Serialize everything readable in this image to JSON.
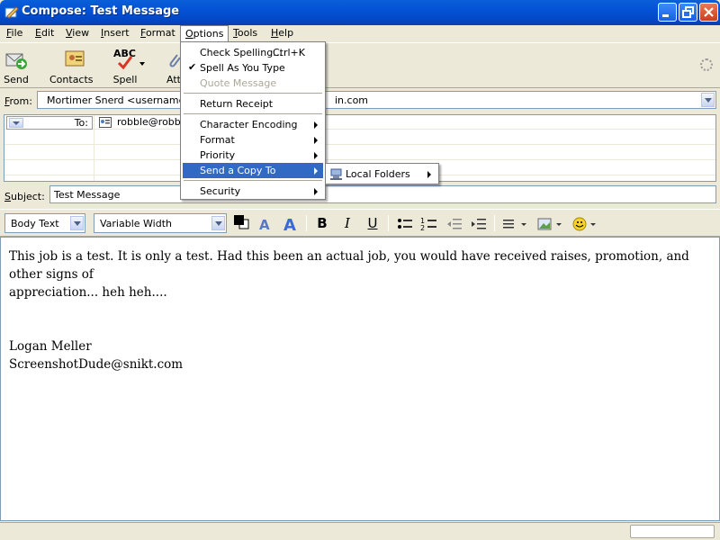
{
  "window": {
    "title": "Compose: Test Message"
  },
  "menubar": {
    "items": [
      {
        "label": "File",
        "u": "F",
        "rest": "ile"
      },
      {
        "label": "Edit",
        "u": "E",
        "rest": "dit"
      },
      {
        "label": "View",
        "u": "V",
        "rest": "iew"
      },
      {
        "label": "Insert",
        "u": "I",
        "rest": "nsert"
      },
      {
        "label": "Format",
        "u": "F",
        "rest": "ormat"
      },
      {
        "label": "Options",
        "u": "O",
        "rest": "ptions"
      },
      {
        "label": "Tools",
        "u": "T",
        "rest": "ools"
      },
      {
        "label": "Help",
        "u": "H",
        "rest": "elp"
      }
    ]
  },
  "toolbar": {
    "send": "Send",
    "contacts": "Contacts",
    "spell": "Spell",
    "attach": "Att",
    "spell_icon_text": "ABC"
  },
  "header": {
    "from_label": "From:",
    "from_value": "Mortimer Snerd <username@d",
    "from_value_tail": "in.com",
    "to_label": "To:",
    "to_value": "robble@robble",
    "subject_label": "Subject:",
    "subject_value": "Test Message"
  },
  "format_bar": {
    "paragraph_style": "Body Text",
    "font": "Variable Width",
    "bold": "B",
    "italic": "I",
    "underline": "U"
  },
  "options_menu": {
    "check_spelling": "Check Spelling...",
    "check_spelling_accel": "Ctrl+K",
    "spell_as_you_type": "Spell As You Type",
    "quote_message": "Quote Message",
    "return_receipt": "Return Receipt",
    "character_encoding": "Character Encoding",
    "format": "Format",
    "priority": "Priority",
    "send_copy_to": "Send a Copy To",
    "security": "Security"
  },
  "send_copy_submenu": {
    "local_folders": "Local Folders"
  },
  "message": {
    "line1": "This job is a test.  It is only a test.  Had this been an actual job, you would have received raises, promotion, and other signs of",
    "line2": "appreciation... heh heh....",
    "signature_name": "Logan Meller",
    "signature_email": "ScreenshotDude@snikt.com"
  },
  "colors": {
    "titlebar": "#0452d6",
    "menu_highlight": "#316ac5",
    "chrome": "#ece9d8"
  }
}
